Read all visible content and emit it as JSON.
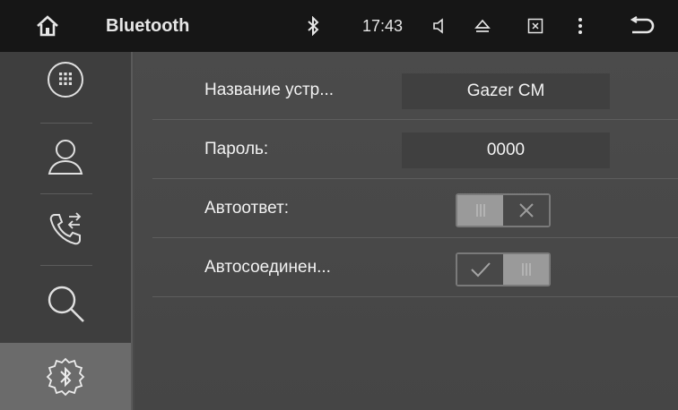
{
  "topbar": {
    "title": "Bluetooth",
    "time": "17:43",
    "icons": [
      "home-icon",
      "bluetooth-icon",
      "volume-icon",
      "eject-icon",
      "screen-off-icon",
      "menu-dots-icon",
      "back-icon"
    ]
  },
  "sidebar": {
    "items": [
      {
        "icon": "dialpad-icon",
        "active": false
      },
      {
        "icon": "contacts-icon",
        "active": false
      },
      {
        "icon": "call-log-icon",
        "active": false
      },
      {
        "icon": "search-icon",
        "active": false
      },
      {
        "icon": "bluetooth-settings-icon",
        "active": true
      }
    ]
  },
  "settings": {
    "device_name": {
      "label": "Название устр...",
      "value": "Gazer CM"
    },
    "password": {
      "label": "Пароль:",
      "value": "0000"
    },
    "auto_answer": {
      "label": "Автоответ:",
      "enabled": false
    },
    "auto_connect": {
      "label": "Автосоединен...",
      "enabled": true
    }
  },
  "colors": {
    "topbar": "#161616",
    "sidebar": "#3e3e3e",
    "sidebar_active": "#6b6b6b",
    "main": "#4a4a4a",
    "value_box": "#404040",
    "toggle_knob": "#9a9a9a"
  }
}
